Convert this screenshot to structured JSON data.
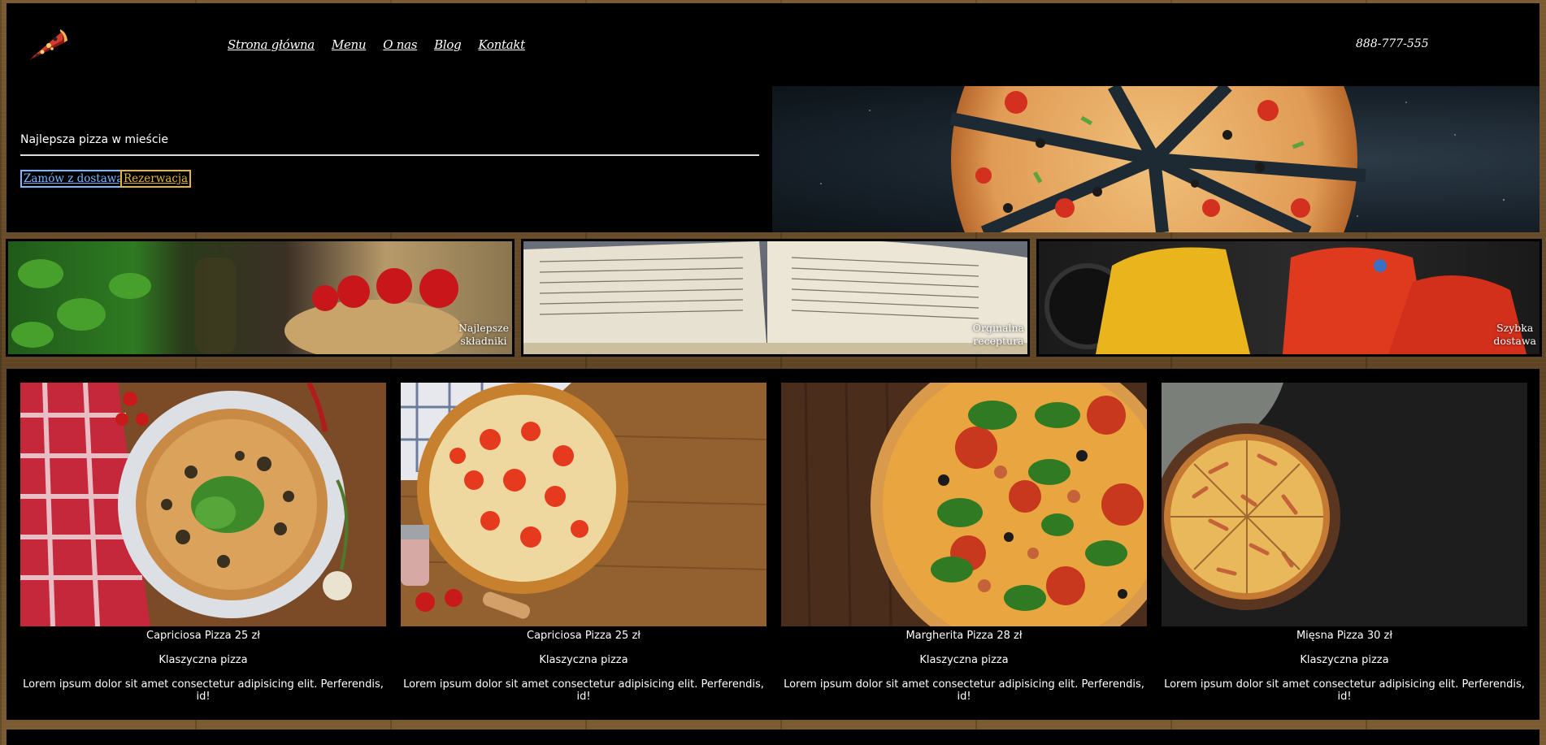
{
  "nav": {
    "items": [
      "Strona główna",
      "Menu",
      "O nas",
      "Blog",
      "Kontakt"
    ]
  },
  "header": {
    "phone": "888-777-555"
  },
  "hero": {
    "title": "Najlepsza pizza w mieście",
    "delivery_button": "Zamów z dostawą",
    "reserve_button": "Rezerwacja"
  },
  "features": [
    {
      "line1": "Najlepsze",
      "line2": "składniki"
    },
    {
      "line1": "Orginalna",
      "line2": "receptura"
    },
    {
      "line1": "Szybka",
      "line2": "dostawa"
    }
  ],
  "products": [
    {
      "name": "Capriciosa Pizza 25 zł",
      "subtitle": "Klaszyczna pizza",
      "description": "Lorem ipsum dolor sit amet consectetur adipisicing elit. Perferendis, id!"
    },
    {
      "name": "Capriciosa Pizza 25 zł",
      "subtitle": "Klaszyczna pizza",
      "description": "Lorem ipsum dolor sit amet consectetur adipisicing elit. Perferendis, id!"
    },
    {
      "name": "Margherita Pizza 28 zł",
      "subtitle": "Klaszyczna pizza",
      "description": "Lorem ipsum dolor sit amet consectetur adipisicing elit. Perferendis, id!"
    },
    {
      "name": "Mięsna Pizza 30 zł",
      "subtitle": "Klaszyczna pizza",
      "description": "Lorem ipsum dolor sit amet consectetur adipisicing elit. Perferendis, id!"
    }
  ],
  "colors": {
    "delivery_accent": "#7ab8ff",
    "reserve_accent": "#e5b533",
    "background": "#000000"
  }
}
